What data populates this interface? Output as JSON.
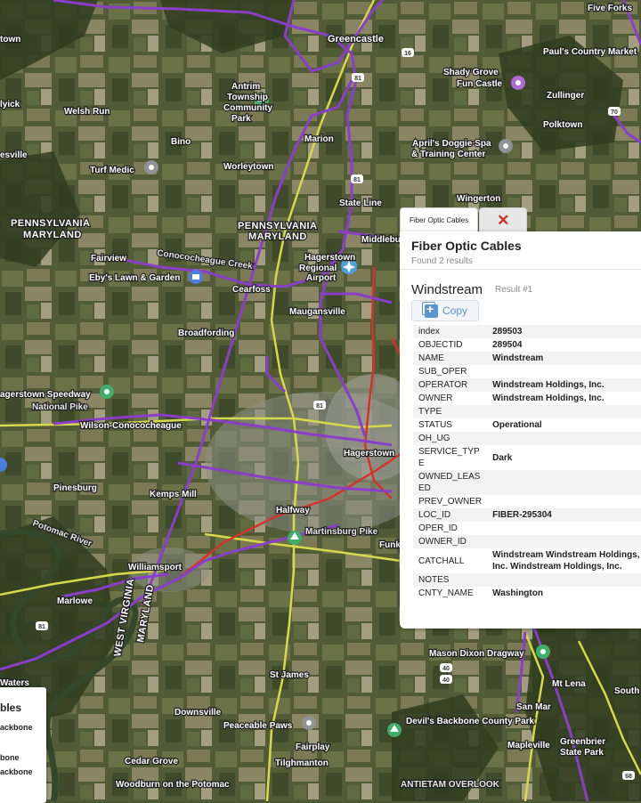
{
  "map": {
    "place_labels": [
      "Five Forks",
      "town",
      "Greencastle",
      "Paul's Country Market",
      "Shady Grove",
      "Fun Castle",
      "Zullinger",
      "Antrim",
      "Township",
      "Community",
      "Park",
      "lyick",
      "Welsh Run",
      "Polktown",
      "Bino",
      "April's Doggie Spa",
      "& Training Center",
      "esville",
      "Turf Medic",
      "Worleytown",
      "Marion",
      "State Line",
      "Wingerton",
      "PENNSYLVANIA",
      "MARYLAND",
      "PENNSYLVANIA",
      "MARYLAND",
      "Middleburg",
      "Hagerstown",
      "Regional",
      "Airport",
      "Fairview",
      "Conococheague Creek",
      "Eby's Lawn & Garden",
      "Cearfoss",
      "Maugansville",
      "Broadfording",
      "agerstown Speedway",
      "National Pike",
      "Wilson-Conococheague",
      "Pinesburg",
      "Kemps Mill",
      "Halfway",
      "Martinsburg Pike",
      "Funkstown",
      "Williamsport",
      "Marlowe",
      "WEST VIRGINIA",
      "MARYLAND",
      "Mason Dixon Dragway",
      "St James",
      "Mt Lena",
      "South Mountain State Park",
      "Downsville",
      "Peaceable Paws",
      "Devil's Backbone County Park",
      "San Mar",
      "Mapleville",
      "Greenbrier",
      "State Park",
      "Fairplay",
      "Tilghmanton",
      "Cedar Grove",
      "Woodburn on the Potomac",
      "ANTIETAM OVERLOOK",
      "Waters",
      "Potomac River",
      "Hagerstown"
    ],
    "road_shields": [
      "16",
      "81",
      "81",
      "81",
      "81",
      "40",
      "40",
      "70",
      "68"
    ],
    "layer_colors": {
      "fiber": "#8a3ec9",
      "red_route": "#d6322c",
      "yellow_route": "#d8d94a"
    }
  },
  "popup": {
    "tab_label": "Fiber Optic Cables",
    "close_label": "✕",
    "title": "Fiber Optic Cables",
    "subtitle": "Found 2 results",
    "feature_name": "Windstream",
    "result_label": "Result #1",
    "copy_label": "Copy",
    "attributes": [
      {
        "key": "index",
        "value": "289503"
      },
      {
        "key": "OBJECTID",
        "value": "289504"
      },
      {
        "key": "NAME",
        "value": "Windstream"
      },
      {
        "key": "SUB_OPER",
        "value": ""
      },
      {
        "key": "OPERATOR",
        "value": "Windstream Holdings, Inc."
      },
      {
        "key": "OWNER",
        "value": "Windstream Holdings, Inc."
      },
      {
        "key": "TYPE",
        "value": ""
      },
      {
        "key": "STATUS",
        "value": "Operational"
      },
      {
        "key": "OH_UG",
        "value": ""
      },
      {
        "key": "SERVICE_TYPE",
        "value": "Dark"
      },
      {
        "key": "OWNED_LEASED",
        "value": ""
      },
      {
        "key": "PREV_OWNER",
        "value": ""
      },
      {
        "key": "LOC_ID",
        "value": "FIBER-295304"
      },
      {
        "key": "OPER_ID",
        "value": ""
      },
      {
        "key": "OWNER_ID",
        "value": ""
      },
      {
        "key": "CATCHALL",
        "value": "Windstream Windstream Holdings, Inc. Windstream Holdings, Inc."
      },
      {
        "key": "NOTES",
        "value": ""
      },
      {
        "key": "CNTY_NAME",
        "value": "Washington"
      }
    ]
  },
  "legend": {
    "title": "bles",
    "items": [
      "ackbone",
      "bone",
      "ackbone"
    ]
  }
}
